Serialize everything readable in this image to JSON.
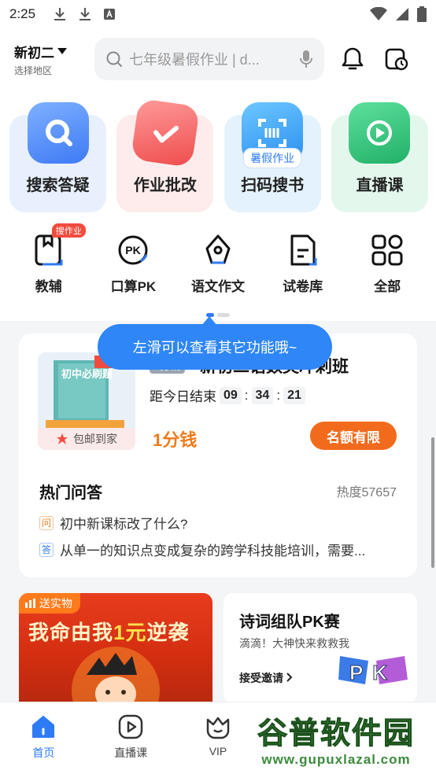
{
  "status_bar": {
    "time": "2:25"
  },
  "header": {
    "grade": "新初二",
    "region": "选择地区",
    "search_placeholder": "七年级暑假作业 | d..."
  },
  "top_tiles": [
    {
      "label": "搜索答疑",
      "icon": "search-icon",
      "color": "#4d8cf7"
    },
    {
      "label": "作业批改",
      "icon": "check-icon",
      "color": "#f25b5b"
    },
    {
      "label": "扫码搜书",
      "icon": "scan-icon",
      "color": "#2ea4f5",
      "badge": "暑假作业"
    },
    {
      "label": "直播课",
      "icon": "play-icon",
      "color": "#2fc47b"
    }
  ],
  "small_items": [
    {
      "label": "教辅",
      "icon": "book-icon",
      "badge": "搜作业"
    },
    {
      "label": "口算PK",
      "icon": "pk-icon"
    },
    {
      "label": "语文作文",
      "icon": "pen-nib-icon"
    },
    {
      "label": "试卷库",
      "icon": "paper-icon"
    },
    {
      "label": "全部",
      "icon": "grid-icon"
    }
  ],
  "tooltip": "左滑可以查看其它功能哦~",
  "promo": {
    "tag": "1分钱",
    "title": "新初二语数英冲刺班",
    "book_cover_text": "初中必刷题",
    "countdown_label": "距今日结束",
    "hours": "09",
    "minutes": "34",
    "seconds": "21",
    "price": "1分钱",
    "button": "名额有限",
    "ship_label": "包邮到家"
  },
  "hot_qa": {
    "title": "热门问答",
    "heat": "热度57657",
    "questions": [
      {
        "mark": "问",
        "text": "初中新课标改了什么?"
      },
      {
        "mark": "答",
        "text": "从单一的知识点变成复杂的跨学科技能培训，需要..."
      }
    ]
  },
  "banner_left": {
    "tag": "送实物",
    "slogan_a": "我命由我",
    "slogan_b": "1元",
    "slogan_c": "逆袭"
  },
  "banner_right": {
    "title": "诗词组队PK赛",
    "subtitle": "滴滴！大神快来救救我",
    "link": "接受邀请",
    "pk_text": "PK"
  },
  "tabs": [
    {
      "label": "首页",
      "icon": "home-icon",
      "active": true
    },
    {
      "label": "直播课",
      "icon": "play-circle-icon"
    },
    {
      "label": "VIP",
      "icon": "vip-crown-icon"
    },
    {
      "label": "",
      "icon": ""
    },
    {
      "label": "",
      "icon": ""
    }
  ],
  "watermark": {
    "big": "谷普软件园",
    "small": "www.gupuxlazal.com"
  },
  "colors": {
    "accent": "#2e7bf6",
    "orange": "#f26b1d",
    "tooltip": "#2e86f7"
  }
}
